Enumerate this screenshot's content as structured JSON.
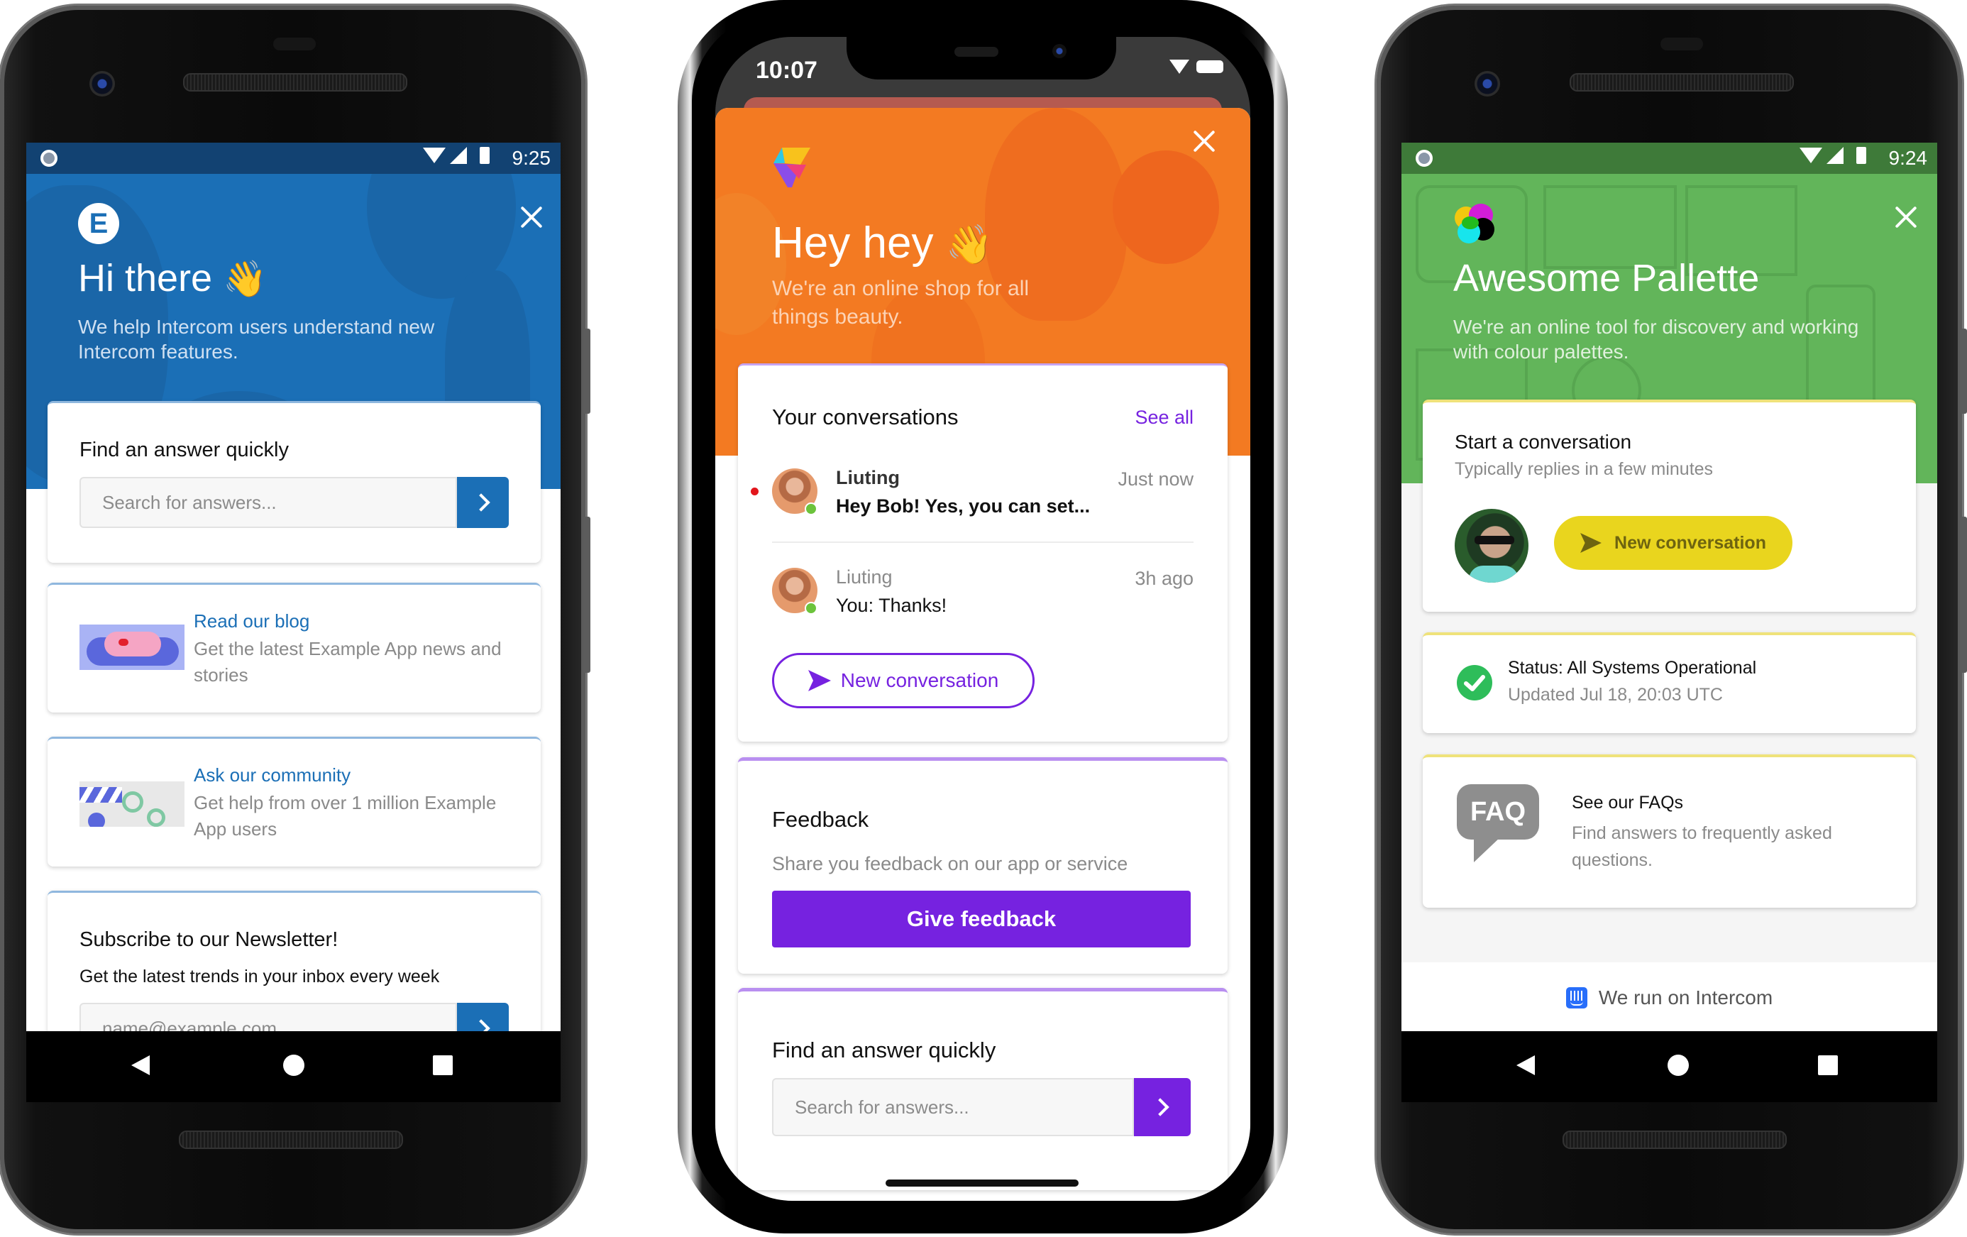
{
  "phones": {
    "left": {
      "status_bar": {
        "time": "9:25"
      },
      "header": {
        "logo_letter": "E",
        "title": "Hi there",
        "wave_emoji": "👋",
        "subtitle_line1": "We help Intercom users understand new",
        "subtitle_line2": "Intercom features."
      },
      "search_card": {
        "title": "Find an answer quickly",
        "placeholder": "Search for answers..."
      },
      "blog_card": {
        "title": "Read our blog",
        "desc_line1": "Get the latest Example App news and",
        "desc_line2": "stories"
      },
      "community_card": {
        "title": "Ask our community",
        "desc_line1": "Get help from over 1 million Example",
        "desc_line2": "App users"
      },
      "newsletter_card": {
        "title": "Subscribe to our Newsletter!",
        "desc": "Get the latest trends in your inbox every week",
        "placeholder": "name@example.com"
      },
      "colors": {
        "brand": "#1b70b8",
        "header_dark": "#124272"
      }
    },
    "middle": {
      "status_bar": {
        "time": "10:07"
      },
      "header": {
        "title": "Hey hey",
        "wave_emoji": "👋",
        "subtitle_line1": "We're an online shop for all",
        "subtitle_line2": "things beauty."
      },
      "conversations_card": {
        "title": "Your conversations",
        "see_all": "See all",
        "items": [
          {
            "name": "Liuting",
            "time": "Just now",
            "message": "Hey Bob! Yes, you can set...",
            "unread": true
          },
          {
            "name": "Liuting",
            "time": "3h ago",
            "message": "You: Thanks!",
            "unread": false
          }
        ],
        "new_conversation": "New conversation"
      },
      "feedback_card": {
        "title": "Feedback",
        "desc": "Share you feedback on our app or service",
        "button": "Give feedback"
      },
      "search_card": {
        "title": "Find an answer quickly",
        "placeholder": "Search for answers..."
      },
      "colors": {
        "brand": "#7622e0",
        "header": "#f37a22"
      }
    },
    "right": {
      "status_bar": {
        "time": "9:24"
      },
      "header": {
        "title": "Awesome Pallette",
        "subtitle_line1": "We're an online tool for discovery and working",
        "subtitle_line2": "with colour palettes."
      },
      "start_card": {
        "title": "Start a conversation",
        "subtitle": "Typically replies in a few minutes",
        "button": "New conversation"
      },
      "status_card": {
        "title": "Status: All Systems Operational",
        "updated": "Updated Jul 18, 20:03 UTC"
      },
      "faq_card": {
        "icon_text": "FAQ",
        "title": "See our FAQs",
        "desc_line1": "Find answers to frequently asked",
        "desc_line2": "questions."
      },
      "footer": {
        "label": "We run on Intercom"
      },
      "colors": {
        "brand": "#62b55a",
        "accent": "#e9d51e"
      }
    }
  }
}
